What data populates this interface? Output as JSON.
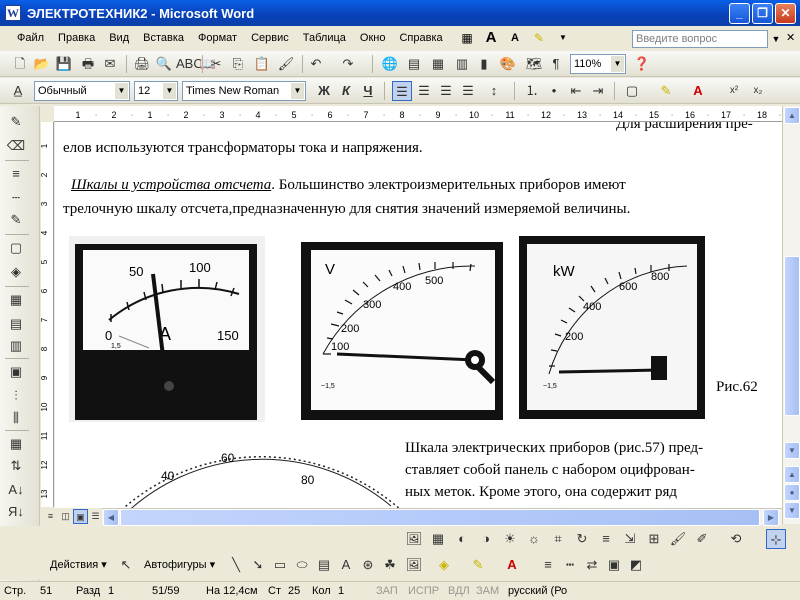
{
  "window": {
    "title": "ЭЛЕКТРОТЕХНИК2 - Microsoft Word",
    "app_icon": "W",
    "buttons": [
      "_",
      "❐",
      "✕"
    ]
  },
  "menu": {
    "items": [
      "Файл",
      "Правка",
      "Вид",
      "Вставка",
      "Формат",
      "Сервис",
      "Таблица",
      "Окно",
      "Справка"
    ],
    "ask_placeholder": "Введите вопрос",
    "close_doc": "✕"
  },
  "formatting": {
    "style": "Обычный",
    "size": "12",
    "font": "Times New Roman",
    "bold": "Ж",
    "italic": "К",
    "underline": "Ч"
  },
  "standard": {
    "zoom": "110%",
    "pilcrow": "¶"
  },
  "ruler": {
    "ticks": [
      "1",
      "2",
      "1",
      "2",
      "3",
      "4",
      "5",
      "6",
      "7",
      "8",
      "9",
      "10",
      "11",
      "12",
      "13",
      "14",
      "15",
      "16",
      "17",
      "18"
    ],
    "vticks": [
      "1",
      "2",
      "3",
      "4",
      "5",
      "6",
      "7",
      "8",
      "9",
      "10",
      "11",
      "12",
      "13"
    ]
  },
  "document": {
    "line_partial": "Для расширения пре-",
    "line1": "елов используются трансформаторы тока и напряжения.",
    "heading": "Шкалы и устройства отсчета",
    "line2_rest": ". Большинство электроизмерительных приборов имеют",
    "line3": "трелочную шкалу отсчета,предназначенную для снятия значений измеряемой величины.",
    "figure_caption": "Рис.62",
    "para2": [
      "Шкала электрических приборов (рис.57) пред-",
      "ставляет собой панель с набором оцифрован-",
      "ных меток. Кроме этого, она содержит ряд"
    ]
  },
  "meters": [
    {
      "unit": "A",
      "scale": [
        "0",
        "50",
        "100",
        "150"
      ],
      "class_mark": "1,5"
    },
    {
      "unit": "V",
      "scale": [
        "100",
        "200",
        "300",
        "400",
        "500"
      ],
      "class_mark": "~1,5"
    },
    {
      "unit": "kW",
      "scale": [
        "200",
        "400",
        "600",
        "800"
      ],
      "class_mark": "~1,5"
    },
    {
      "unit": "",
      "scale": [
        "40",
        "60",
        "80"
      ],
      "class_mark": ""
    }
  ],
  "drawing": {
    "actions": "Действия",
    "autoshapes": "Автофигуры"
  },
  "status": {
    "page": "Стр.",
    "page_num": "51",
    "section": "Разд",
    "section_num": "1",
    "pages": "51/59",
    "at": "На 12,4см",
    "line": "Ст",
    "line_num": "25",
    "col": "Кол",
    "col_num": "1",
    "rec": "ЗАП",
    "trk": "ИСПР",
    "ext": "ВДЛ",
    "ovr": "ЗАМ",
    "lang": "русский (Ро"
  },
  "colors": {
    "titlebar": "#0a5fe6",
    "toolbar": "#ece9d8",
    "highlight": "#ffff00",
    "font_color": "#ff0000"
  }
}
